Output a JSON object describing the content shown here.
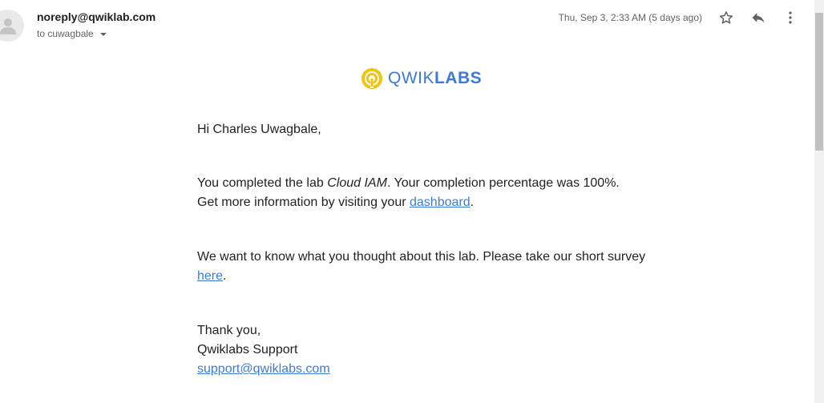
{
  "header": {
    "sender": "noreply@qwiklab.com",
    "recipient": "to cuwagbale",
    "date": "Thu, Sep 3, 2:33 AM (5 days ago)"
  },
  "logo": {
    "part1": "QWIK",
    "part2": "LABS",
    "accent_color": "#3b7bd8",
    "ring_color": "#f2c311"
  },
  "body": {
    "greeting": "Hi Charles Uwagbale,",
    "p1_prefix": "You completed the lab ",
    "p1_lab": "Cloud IAM",
    "p1_suffix": ". Your completion percentage was 100%.",
    "p1_line2_prefix": "Get more information by visiting your ",
    "p1_link": "dashboard",
    "p1_line2_suffix": ".",
    "p2_text": "We want to know what you thought about this lab. Please take our short survey ",
    "p2_link": "here",
    "p2_suffix": ".",
    "closing1": "Thank you,",
    "closing2": "Qwiklabs Support",
    "support_email": "support@qwiklabs.com"
  }
}
